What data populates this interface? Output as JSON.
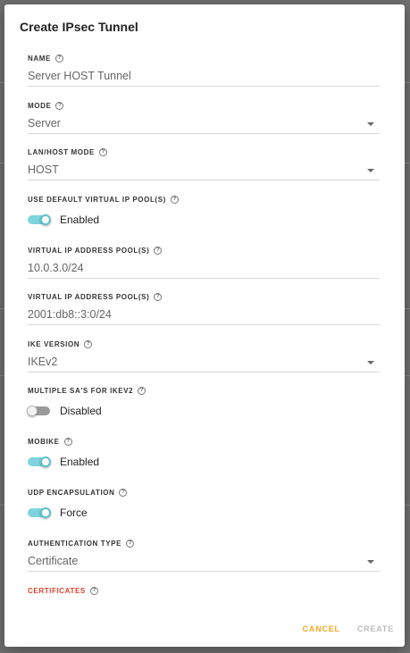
{
  "dialog": {
    "title": "Create IPsec Tunnel",
    "fields": {
      "name": {
        "label": "NAME",
        "value": "Server HOST Tunnel"
      },
      "mode": {
        "label": "MODE",
        "value": "Server"
      },
      "lan_host_mode": {
        "label": "LAN/HOST MODE",
        "value": "HOST"
      },
      "default_pool": {
        "label": "USE DEFAULT VIRTUAL IP POOL(S)",
        "state": "Enabled",
        "on": true
      },
      "pool_v4": {
        "label": "VIRTUAL IP ADDRESS POOL(S)",
        "value": "10.0.3.0/24"
      },
      "pool_v6": {
        "label": "VIRTUAL IP ADDRESS POOL(S)",
        "value": "2001:db8::3:0/24"
      },
      "ike_version": {
        "label": "IKE VERSION",
        "value": "IKEv2"
      },
      "multiple_sa": {
        "label": "MULTIPLE SA'S FOR IKEV2",
        "state": "Disabled",
        "on": false
      },
      "mobike": {
        "label": "MOBIKE",
        "state": "Enabled",
        "on": true
      },
      "udp_encap": {
        "label": "UDP ENCAPSULATION",
        "state": "Force",
        "on": true
      },
      "auth_type": {
        "label": "AUTHENTICATION TYPE",
        "value": "Certificate"
      },
      "certificates": {
        "label": "CERTIFICATES"
      }
    },
    "help_glyph": "?",
    "buttons": {
      "cancel": "CANCEL",
      "create": "CREATE"
    }
  },
  "colors": {
    "accent_toggle": "#7fd3dc",
    "cancel": "#f5a623",
    "create_disabled": "#bdbdbd",
    "error_label": "#e0402b"
  }
}
